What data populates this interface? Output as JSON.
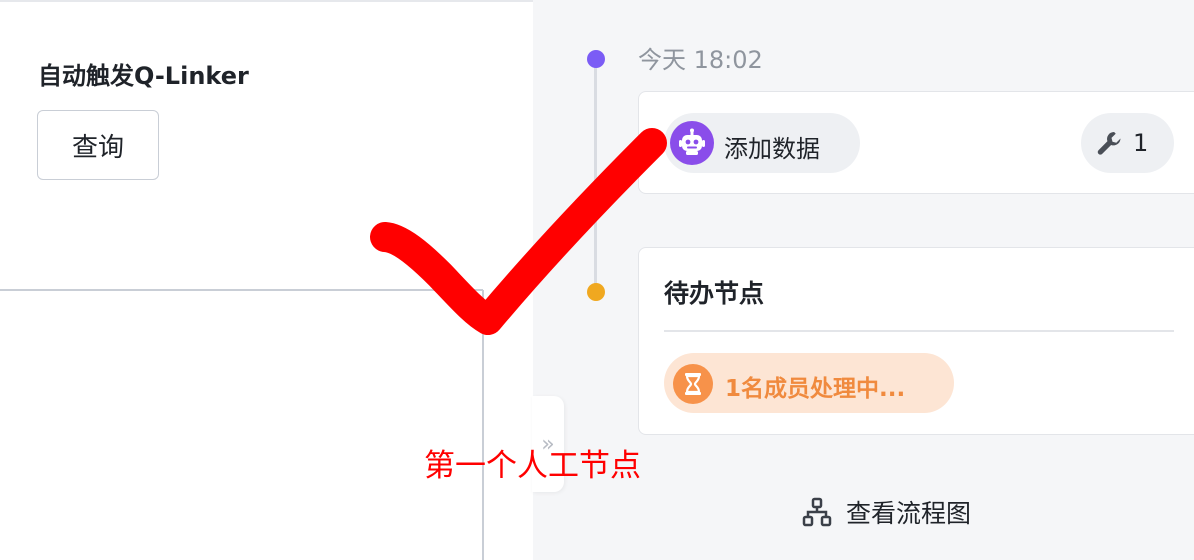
{
  "left": {
    "trigger_title": "自动触发Q-Linker",
    "query_button": "查询"
  },
  "collapse": {
    "glyph": "»"
  },
  "timeline": {
    "time": "今天 18:02",
    "items": [
      {
        "robot_label": "添加数据",
        "tool_count": "1"
      },
      {
        "title": "待办节点",
        "status": "1名成员处理中..."
      }
    ]
  },
  "flow_link": {
    "label": "查看流程图"
  },
  "annotation": {
    "text": "第一个人工节点"
  },
  "colors": {
    "timeline_dot_1": "#7b5cf5",
    "timeline_dot_2": "#f0a820",
    "robot": "#8a4dea",
    "status": "#f7924a",
    "annotation": "#ff0000"
  },
  "icons": [
    "robot-icon",
    "wrench-icon",
    "hourglass-icon",
    "flowchart-icon",
    "double-chevron-right-icon"
  ]
}
